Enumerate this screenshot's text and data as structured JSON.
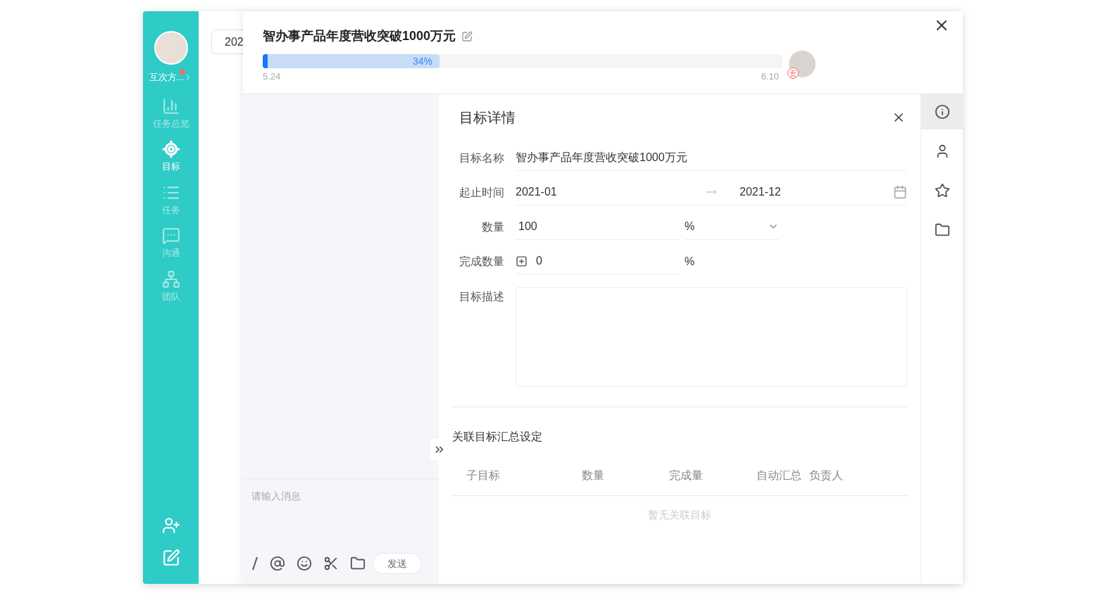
{
  "sidebar": {
    "user_name": "互次方...",
    "unread": true,
    "nav": [
      {
        "kind": "overview",
        "label": "任务总览",
        "selected": false
      },
      {
        "kind": "goal",
        "label": "目标",
        "selected": true
      },
      {
        "kind": "task",
        "label": "任务",
        "selected": false
      },
      {
        "kind": "chat",
        "label": "沟通",
        "selected": false
      },
      {
        "kind": "team",
        "label": "团队",
        "selected": false
      }
    ]
  },
  "background_field": {
    "value": "202"
  },
  "goal": {
    "title": "智办事产品年度营收突破1000万元",
    "progress": {
      "level": 0.34,
      "reading": "34%",
      "start": "5.24",
      "end": "6.10"
    },
    "owner_badge": "责"
  },
  "chat": {
    "placeholder": "请输入消息",
    "send": "发送"
  },
  "details": {
    "title": "目标详情",
    "name": {
      "label": "目标名称",
      "value": "智办事产品年度营收突破1000万元"
    },
    "time": {
      "label": "起止时间",
      "start": "2021-01",
      "end": "2021-12"
    },
    "quantity": {
      "label": "数量",
      "value": "100",
      "unit": "%"
    },
    "completed": {
      "label": "完成数量",
      "value": "0",
      "unit": "%"
    },
    "description": {
      "label": "目标描述"
    }
  },
  "summary": {
    "title": "关联目标汇总设定",
    "columns": [
      "子目标",
      "数量",
      "完成量",
      "自动汇总",
      "负责人"
    ],
    "empty": "暂无关联目标"
  },
  "side_rail": [
    {
      "kind": "info",
      "selected": true
    },
    {
      "kind": "person",
      "selected": false
    },
    {
      "kind": "star",
      "selected": false
    },
    {
      "kind": "folder",
      "selected": false
    }
  ]
}
